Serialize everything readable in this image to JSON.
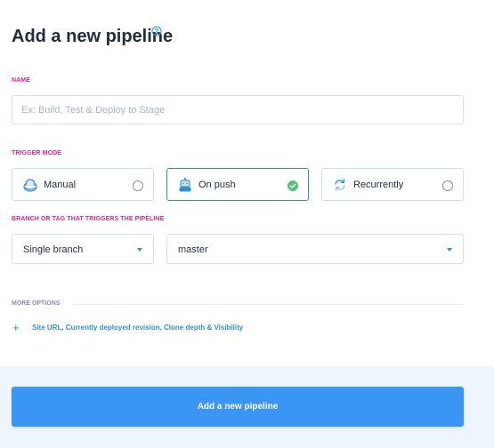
{
  "header": {
    "title": "Add a new pipeline",
    "help_icon": "question-circle-icon"
  },
  "name_section": {
    "label": "NAME",
    "placeholder": "Ex: Build, Test & Deploy to Stage",
    "value": ""
  },
  "trigger_section": {
    "label": "TRIGGER MODE",
    "modes": [
      {
        "label": "Manual",
        "icon": "hand-stop-icon",
        "selected": false
      },
      {
        "label": "On push",
        "icon": "robot-icon",
        "selected": true
      },
      {
        "label": "Recurrently",
        "icon": "refresh-icon",
        "selected": false
      }
    ]
  },
  "branch_section": {
    "label": "BRANCH OR TAG THAT TRIGGERS THE PIPELINE",
    "branch_type": "Single branch",
    "branch_name": "master"
  },
  "more_options": {
    "label": "MORE OPTIONS",
    "link": "Site URL, Currently deployed revision, Clone depth & Visibility",
    "plus_symbol": "+"
  },
  "footer": {
    "submit_label": "Add a new pipeline"
  },
  "colors": {
    "accent": "#2f8fdd",
    "button": "#3a95f5",
    "section_label": "#e91e8c",
    "checked": "#58c27d",
    "footer_bg": "#eef5fd"
  }
}
